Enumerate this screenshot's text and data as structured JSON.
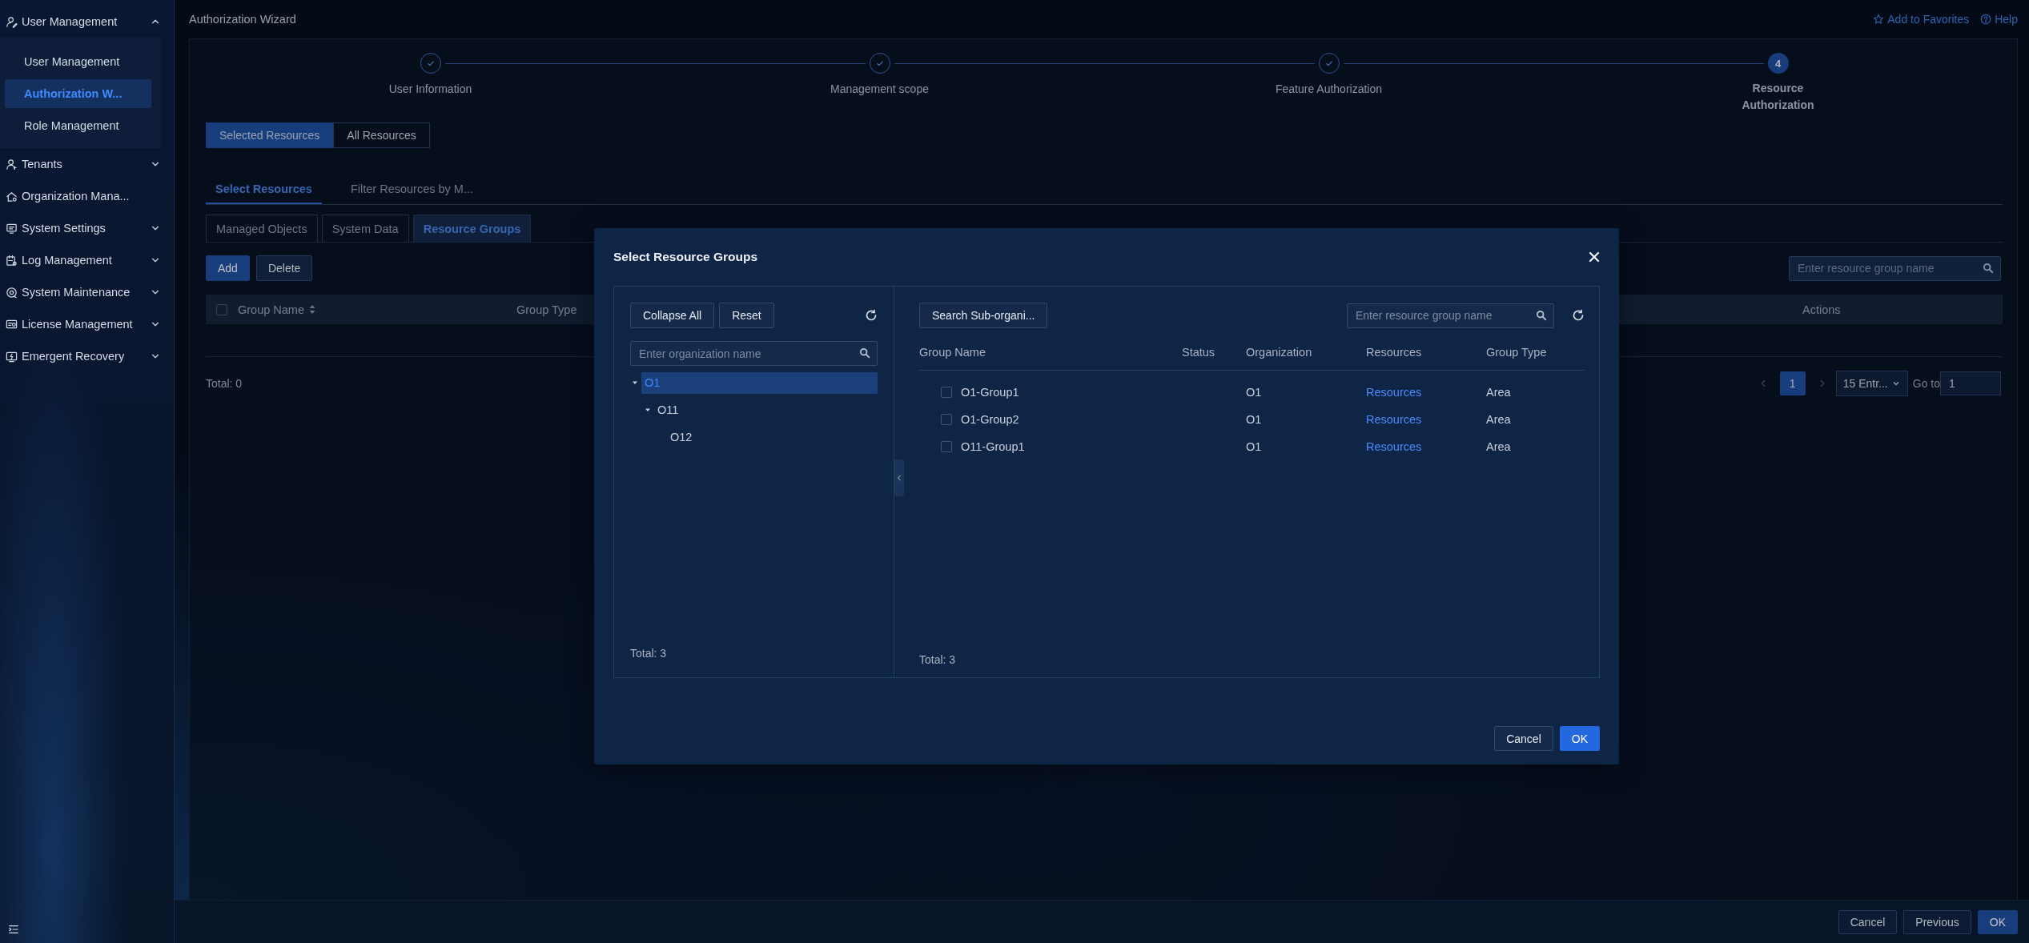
{
  "sidebar": {
    "groups": [
      {
        "label": "User Management",
        "kind": "user-edit",
        "expanded": true,
        "children": [
          {
            "label": "User Management",
            "selected": false
          },
          {
            "label": "Authorization W...",
            "selected": true
          },
          {
            "label": "Role Management",
            "selected": false
          }
        ]
      },
      {
        "label": "Tenants",
        "kind": "tenant",
        "expanded": false
      },
      {
        "label": "Organization Mana...",
        "kind": "org"
      },
      {
        "label": "System Settings",
        "kind": "settings",
        "expanded": false
      },
      {
        "label": "Log Management",
        "kind": "log",
        "expanded": false
      },
      {
        "label": "System Maintenance",
        "kind": "maintenance",
        "expanded": false
      },
      {
        "label": "License Management",
        "kind": "license",
        "expanded": false
      },
      {
        "label": "Emergent Recovery",
        "kind": "recovery",
        "expanded": false
      }
    ]
  },
  "page": {
    "title": "Authorization Wizard",
    "favorites": "Add to Favorites",
    "help": "Help",
    "steps": [
      {
        "label": "User Information",
        "completed": true
      },
      {
        "label": "Management scope",
        "completed": true
      },
      {
        "label": "Feature Authorization",
        "completed": true
      },
      {
        "number": "4",
        "label": "Resource Authorization",
        "completed": false
      }
    ],
    "scope_toggle": [
      {
        "label": "Selected Resources",
        "selected": true
      },
      {
        "label": "All Resources",
        "selected": false
      }
    ],
    "tabs": [
      {
        "label": "Select Resources",
        "selected": true
      },
      {
        "label": "Filter Resources by M...",
        "selected": false
      }
    ],
    "subtabs": [
      {
        "label": "Managed Objects",
        "selected": false
      },
      {
        "label": "System Data",
        "selected": false
      },
      {
        "label": "Resource Groups",
        "selected": true
      }
    ],
    "actions": [
      {
        "label": "Add",
        "primary": true
      },
      {
        "label": "Delete",
        "primary": false
      }
    ],
    "search": {
      "placeholder": "Enter resource group name"
    },
    "table": {
      "all_checked": false,
      "columns": [
        {
          "label": "Group Name",
          "sortable": true
        },
        {
          "label": "Group Type",
          "sortable": false
        },
        {
          "label": "Actions",
          "sortable": false
        }
      ],
      "total": "Total: 0"
    },
    "pagination": {
      "pages": [
        {
          "label": "1",
          "selected": true
        }
      ],
      "page_size": "15 Entr...",
      "goto_label": "Go to",
      "goto_value": "1"
    }
  },
  "modal": {
    "title": "Select Resource Groups",
    "tree_buttons": [
      "Collapse All",
      "Reset"
    ],
    "tree_search": {
      "placeholder": "Enter organization name"
    },
    "tree": [
      {
        "label": "O1",
        "selected": true,
        "expanded": true,
        "children": [
          {
            "label": "O11",
            "selected": false,
            "expanded": true,
            "children": [
              {
                "label": "O12",
                "selected": false
              }
            ]
          }
        ]
      }
    ],
    "tree_total": "Total: 3",
    "search_button": "Search Sub-organi...",
    "group_search": {
      "placeholder": "Enter resource group name"
    },
    "columns": [
      "Group Name",
      "Status",
      "Organization",
      "Resources",
      "Group Type"
    ],
    "rows": [
      {
        "checked": false,
        "name": "O1-Group1",
        "organization": "O1",
        "resources": "Resources",
        "group_type": "Area"
      },
      {
        "checked": false,
        "name": "O1-Group2",
        "organization": "O1",
        "resources": "Resources",
        "group_type": "Area"
      },
      {
        "checked": false,
        "name": "O11-Group1",
        "organization": "O1",
        "resources": "Resources",
        "group_type": "Area"
      }
    ],
    "table_total": "Total: 3",
    "buttons": [
      {
        "label": "Cancel",
        "primary": false
      },
      {
        "label": "OK",
        "primary": true
      }
    ]
  },
  "footer": {
    "buttons": [
      {
        "label": "Cancel",
        "primary": false
      },
      {
        "label": "Previous",
        "primary": false
      },
      {
        "label": "OK",
        "primary": true
      }
    ]
  }
}
